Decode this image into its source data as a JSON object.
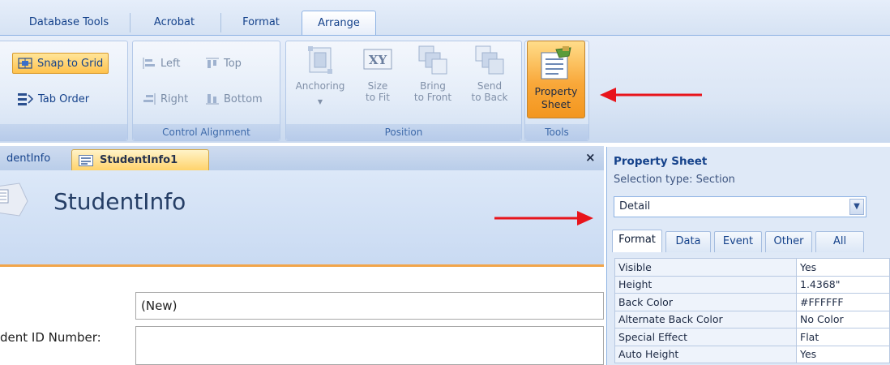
{
  "ribbon_tabs": [
    {
      "label": "Database Tools",
      "active": false
    },
    {
      "label": "Acrobat",
      "active": false
    },
    {
      "label": "Format",
      "active": false
    },
    {
      "label": "Arrange",
      "active": true
    }
  ],
  "ribbon": {
    "control_layout": {
      "snap_to_grid": "Snap to Grid",
      "tab_order": "Tab Order"
    },
    "control_alignment": {
      "label": "Control Alignment",
      "left": "Left",
      "top": "Top",
      "right": "Right",
      "bottom": "Bottom"
    },
    "position": {
      "label": "Position",
      "anchoring": "Anchoring",
      "size_to_fit_1": "Size",
      "size_to_fit_2": "to Fit",
      "bring_to_front_1": "Bring",
      "bring_to_front_2": "to Front",
      "send_to_back_1": "Send",
      "send_to_back_2": "to Back"
    },
    "tools": {
      "label": "Tools",
      "property_sheet_1": "Property",
      "property_sheet_2": "Sheet"
    }
  },
  "doc_tabs": [
    {
      "label": "dentInfo",
      "active": false
    },
    {
      "label": "StudentInfo1",
      "active": true
    }
  ],
  "close_glyph": "×",
  "form": {
    "title": "StudentInfo",
    "field_new_value": "(New)",
    "student_id_label": "dent ID Number:"
  },
  "property_sheet": {
    "title": "Property Sheet",
    "selection_type": "Selection type:  Section",
    "selected_object": "Detail",
    "tabs": [
      {
        "label": "Format",
        "active": true
      },
      {
        "label": "Data",
        "active": false
      },
      {
        "label": "Event",
        "active": false
      },
      {
        "label": "Other",
        "active": false
      },
      {
        "label": "All",
        "active": false
      }
    ],
    "rows": [
      {
        "key": "Visible",
        "value": "Yes"
      },
      {
        "key": "Height",
        "value": "1.4368\""
      },
      {
        "key": "Back Color",
        "value": "#FFFFFF"
      },
      {
        "key": "Alternate Back Color",
        "value": "No Color"
      },
      {
        "key": "Special Effect",
        "value": "Flat"
      },
      {
        "key": "Auto Height",
        "value": "Yes"
      }
    ]
  },
  "colors": {
    "accent_orange": "#f9a83a",
    "annotation_arrow": "#e8141b",
    "ribbon_text": "#15428b"
  }
}
